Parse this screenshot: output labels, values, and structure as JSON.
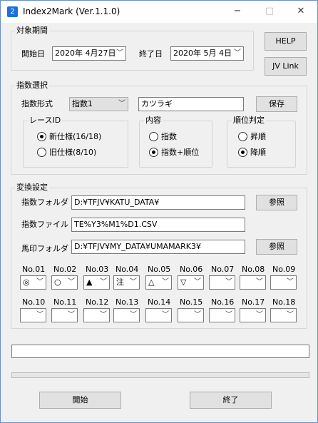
{
  "window": {
    "title": "Index2Mark (Ver.1.1.0)",
    "app_icon": "2",
    "minimize": "−",
    "maximize": "□",
    "close": "✕"
  },
  "period": {
    "legend": "対象期間",
    "start_label": "開始日",
    "start_date": "2020年  4月27日",
    "end_label": "終了日",
    "end_date": "2020年  5月  4日"
  },
  "buttons": {
    "help": "HELP",
    "jvlink": "JV Link",
    "save": "保存",
    "browse1": "参照",
    "browse2": "参照",
    "start": "開始",
    "end": "終了"
  },
  "index_select": {
    "legend": "指数選択",
    "format_label": "指数形式",
    "format_value": "指数1",
    "name_value": "カツラギ",
    "race_id": {
      "legend": "レースID",
      "opt_new": "新仕様(16/18)",
      "opt_old": "旧仕様(8/10)",
      "selected": "new"
    },
    "content": {
      "legend": "内容",
      "opt_index": "指数",
      "opt_index_rank": "指数+順位",
      "selected": "index_rank"
    },
    "rank": {
      "legend": "順位判定",
      "opt_asc": "昇順",
      "opt_desc": "降順",
      "selected": "desc"
    }
  },
  "convert": {
    "legend": "変換設定",
    "folder_label": "指数フォルダ",
    "folder_value": "D:¥TFJV¥KATU_DATA¥",
    "file_label": "指数ファイル",
    "file_value": "TE%Y3%M1%D1.CSV",
    "mark_folder_label": "馬印フォルダ",
    "mark_folder_value": "D:¥TFJV¥MY_DATA¥UMAMARK3¥"
  },
  "marks_row1": [
    {
      "label": "No.01",
      "value": "◎"
    },
    {
      "label": "No.02",
      "value": "○"
    },
    {
      "label": "No.03",
      "value": "▲"
    },
    {
      "label": "No.04",
      "value": "注"
    },
    {
      "label": "No.05",
      "value": "△"
    },
    {
      "label": "No.06",
      "value": "▽"
    },
    {
      "label": "No.07",
      "value": ""
    },
    {
      "label": "No.08",
      "value": ""
    },
    {
      "label": "No.09",
      "value": ""
    }
  ],
  "marks_row2": [
    {
      "label": "No.10",
      "value": ""
    },
    {
      "label": "No.11",
      "value": ""
    },
    {
      "label": "No.12",
      "value": ""
    },
    {
      "label": "No.13",
      "value": ""
    },
    {
      "label": "No.14",
      "value": ""
    },
    {
      "label": "No.15",
      "value": ""
    },
    {
      "label": "No.16",
      "value": ""
    },
    {
      "label": "No.17",
      "value": ""
    },
    {
      "label": "No.18",
      "value": ""
    }
  ],
  "status": {
    "message": "",
    "progress": 0
  },
  "icons": {
    "dropdown": "chevron-down-icon"
  }
}
